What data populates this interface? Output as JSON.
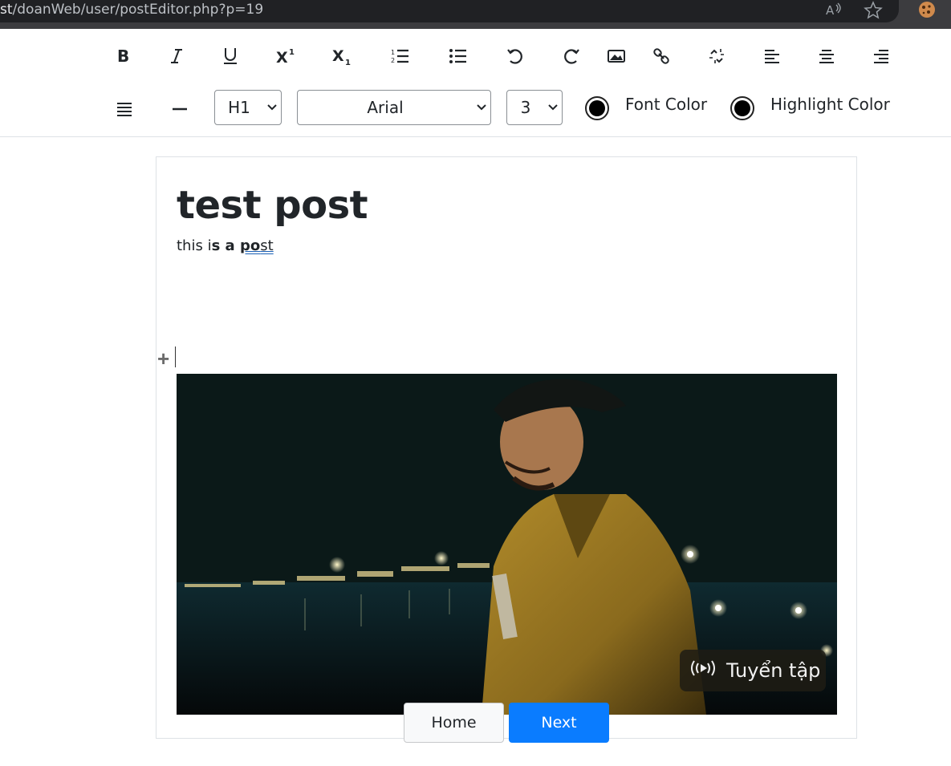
{
  "browser": {
    "url_prefix": "st",
    "url_path": "/doanWeb/user/postEditor.php?p=19",
    "icons": [
      "read-aloud-icon",
      "favorite-star-icon",
      "cookie-extension-icon"
    ]
  },
  "toolbar": {
    "row1": [
      {
        "name": "bold-button",
        "icon": "bold-icon"
      },
      {
        "name": "italic-button",
        "icon": "italic-icon"
      },
      {
        "name": "underline-button",
        "icon": "underline-icon"
      },
      {
        "name": "superscript-button",
        "icon": "superscript-icon"
      },
      {
        "name": "subscript-button",
        "icon": "subscript-icon"
      },
      {
        "name": "ordered-list-button",
        "icon": "ordered-list-icon"
      },
      {
        "name": "unordered-list-button",
        "icon": "unordered-list-icon"
      },
      {
        "name": "undo-button",
        "icon": "undo-icon"
      },
      {
        "name": "redo-button",
        "icon": "redo-icon"
      },
      {
        "name": "insert-image-button",
        "icon": "image-icon"
      },
      {
        "name": "insert-link-button",
        "icon": "link-icon"
      },
      {
        "name": "unlink-button",
        "icon": "unlink-icon"
      },
      {
        "name": "align-left-button",
        "icon": "align-left-icon"
      },
      {
        "name": "align-center-button",
        "icon": "align-center-icon"
      },
      {
        "name": "align-right-button",
        "icon": "align-right-icon"
      }
    ],
    "heading_select": "H1",
    "font_select": "Arial",
    "size_select": "3",
    "font_color_label": "Font Color",
    "highlight_color_label": "Highlight Color",
    "font_color": "#000000",
    "highlight_color": "#000000"
  },
  "editor": {
    "title": "test post",
    "para": {
      "p1": "this i",
      "p2": "s a ",
      "p3": "po",
      "p4": "st"
    },
    "image": {
      "badge_text": "Tuyển tập",
      "badge_icon": "broadcast-icon"
    }
  },
  "nav": {
    "home_label": "Home",
    "next_label": "Next",
    "next_color": "#0a7cff"
  }
}
